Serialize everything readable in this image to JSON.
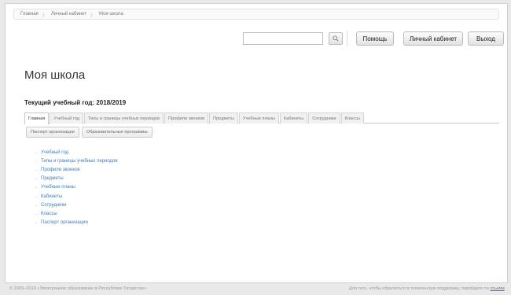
{
  "breadcrumb": [
    "Главная",
    "Личный кабинет",
    "Моя школа"
  ],
  "header": {
    "search_value": "",
    "help_label": "Помощь",
    "cabinet_label": "Личный кабинет",
    "logout_label": "Выход"
  },
  "page": {
    "title": "Моя школа",
    "year_label": "Текущий учебный год: 2018/2019"
  },
  "tabs": [
    {
      "label": "Главная",
      "active": true
    },
    {
      "label": "Учебный год"
    },
    {
      "label": "Типы и границы учебных периодов"
    },
    {
      "label": "Профили звонков"
    },
    {
      "label": "Предметы"
    },
    {
      "label": "Учебные планы"
    },
    {
      "label": "Кабинеты"
    },
    {
      "label": "Сотрудники"
    },
    {
      "label": "Классы"
    }
  ],
  "subtabs": [
    "Паспорт организации",
    "Образовательные программы"
  ],
  "nav_links": [
    "Учебный год",
    "Типы и границы учебных периодов",
    "Профили звонков",
    "Предметы",
    "Учебные планы",
    "Кабинеты",
    "Сотрудники",
    "Классы",
    "Паспорт организации"
  ],
  "footer": {
    "copyright": "© 2009–2018 «Электронное образование в Республике Татарстан»",
    "support_text": "Для того, чтобы обратиться в техническую поддержку, перейдите по",
    "support_link": "ссылке"
  }
}
